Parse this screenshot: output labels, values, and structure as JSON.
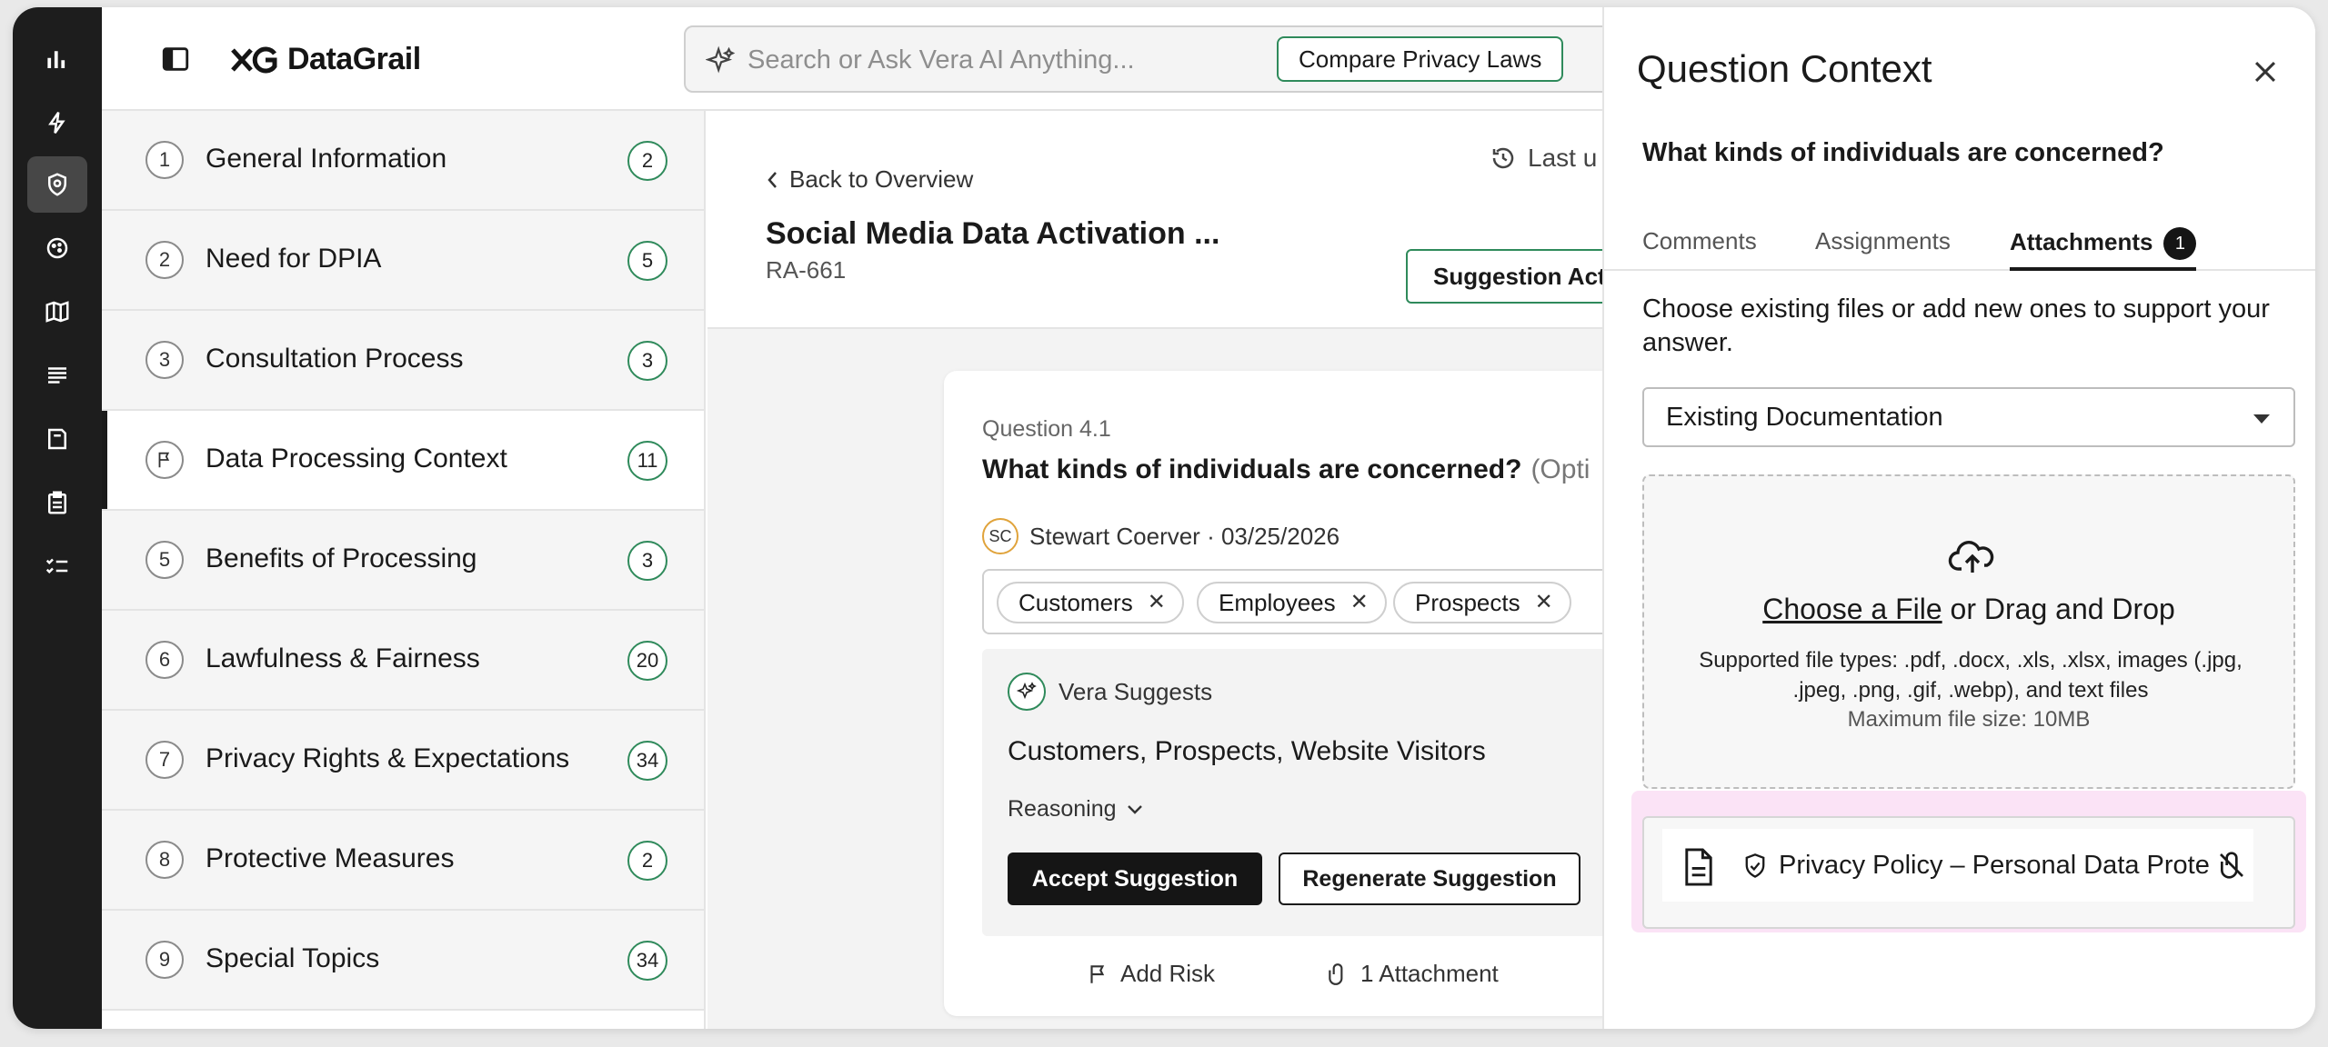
{
  "header": {
    "logo_text": "DataGrail",
    "search_placeholder": "Search or Ask Vera AI Anything...",
    "compare_button": "Compare Privacy Laws"
  },
  "rail": {
    "icons": [
      "chart-icon",
      "bolt-icon",
      "shield-icon",
      "cookie-icon",
      "map-icon",
      "list-icon",
      "book-icon",
      "clipboard-icon",
      "checklist-icon"
    ],
    "active_index": 2
  },
  "sections": [
    {
      "num": "1",
      "label": "General Information",
      "count": "2"
    },
    {
      "num": "2",
      "label": "Need for DPIA",
      "count": "5"
    },
    {
      "num": "3",
      "label": "Consultation Process",
      "count": "3"
    },
    {
      "num": "",
      "label": "Data Processing Context",
      "count": "11",
      "active": true
    },
    {
      "num": "5",
      "label": "Benefits of Processing",
      "count": "3"
    },
    {
      "num": "6",
      "label": "Lawfulness & Fairness",
      "count": "20"
    },
    {
      "num": "7",
      "label": "Privacy Rights & Expectations",
      "count": "34"
    },
    {
      "num": "8",
      "label": "Protective Measures",
      "count": "2"
    },
    {
      "num": "9",
      "label": "Special Topics",
      "count": "34"
    }
  ],
  "main": {
    "back_link": "Back to Overview",
    "history_text": "Last u",
    "title": "Social Media Data Activation ...",
    "id": "RA-661",
    "suggestion_button": "Suggestion Act"
  },
  "question": {
    "number": "Question 4.1",
    "text": "What kinds of individuals are concerned?",
    "optional": "(Opti",
    "author_initials": "SC",
    "author_line": "Stewart Coerver · 03/25/2026",
    "tags": [
      "Customers",
      "Employees",
      "Prospects"
    ],
    "vera_label": "Vera Suggests",
    "vera_suggestion": "Customers, Prospects, Website Visitors",
    "reasoning_label": "Reasoning",
    "accept_button": "Accept Suggestion",
    "regenerate_button": "Regenerate Suggestion",
    "add_risk": "Add Risk",
    "attachment_count": "1 Attachment"
  },
  "panel": {
    "title": "Question Context",
    "question": "What kinds of individuals are concerned?",
    "tabs": [
      {
        "label": "Comments"
      },
      {
        "label": "Assignments"
      },
      {
        "label": "Attachments",
        "badge": "1",
        "active": true
      }
    ],
    "help_text": "Choose existing files or add new ones to support your answer.",
    "select_value": "Existing Documentation",
    "dropzone": {
      "choose_link": "Choose a File",
      "or_text": " or Drag and Drop",
      "types": "Supported file types: .pdf, .docx, .xls, .xlsx, images (.jpg, .jpeg, .png, .gif, .webp), and text files",
      "max": "Maximum file size: 10MB"
    },
    "attachment_name": "Privacy Policy – Personal Data Prote",
    "highlight_color": "#fbe3f6"
  },
  "colors": {
    "accent_green": "#2f8a5b",
    "rail_bg": "#1d1d1d"
  }
}
